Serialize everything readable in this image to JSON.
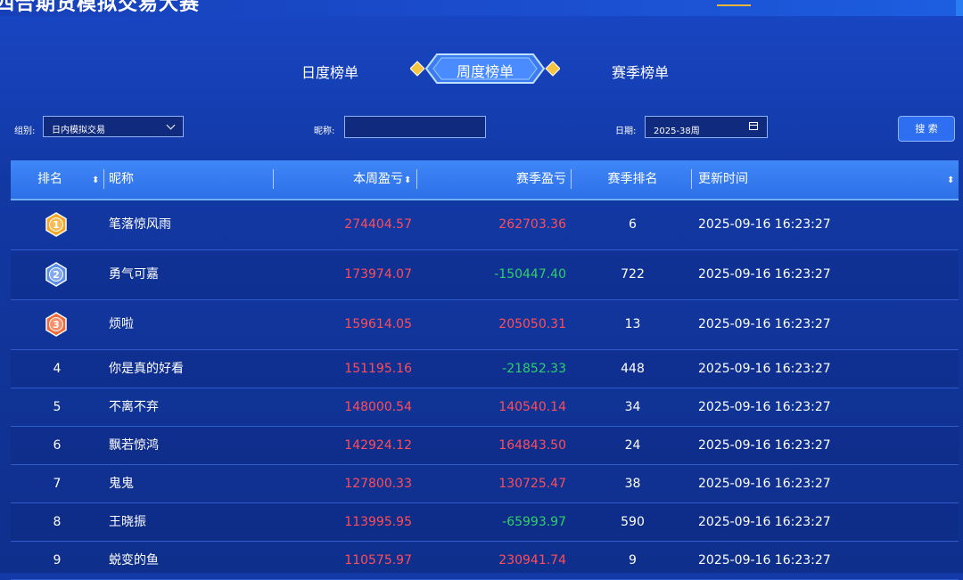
{
  "header": {
    "title": "四合期货模拟交易大赛"
  },
  "tabs": [
    {
      "label": "日度榜单",
      "active": false
    },
    {
      "label": "周度榜单",
      "active": true
    },
    {
      "label": "赛季榜单",
      "active": false
    }
  ],
  "filters": {
    "group_label": "组别:",
    "group_value": "日内模拟交易",
    "nickname_label": "昵称:",
    "nickname_value": "",
    "date_label": "日期:",
    "date_value": "2025-38周",
    "search_label": "搜 索"
  },
  "table": {
    "columns": [
      "排名",
      "昵称",
      "本周盈亏",
      "赛季盈亏",
      "赛季排名",
      "更新时间"
    ],
    "sort_glyph": "⬍",
    "rows": [
      {
        "rank": "1",
        "name": "笔落惊风雨",
        "week": "274404.57",
        "season": "262703.36",
        "season_sign": "pos",
        "season_rank": "6",
        "time": "2025-09-16 16:23:27"
      },
      {
        "rank": "2",
        "name": "勇气可嘉",
        "week": "173974.07",
        "season": "-150447.40",
        "season_sign": "neg",
        "season_rank": "722",
        "time": "2025-09-16 16:23:27"
      },
      {
        "rank": "3",
        "name": "烦啦",
        "week": "159614.05",
        "season": "205050.31",
        "season_sign": "pos",
        "season_rank": "13",
        "time": "2025-09-16 16:23:27"
      },
      {
        "rank": "4",
        "name": "你是真的好看",
        "week": "151195.16",
        "season": "-21852.33",
        "season_sign": "neg",
        "season_rank": "448",
        "time": "2025-09-16 16:23:27"
      },
      {
        "rank": "5",
        "name": "不离不弃",
        "week": "148000.54",
        "season": "140540.14",
        "season_sign": "pos",
        "season_rank": "34",
        "time": "2025-09-16 16:23:27"
      },
      {
        "rank": "6",
        "name": "飘若惊鸿",
        "week": "142924.12",
        "season": "164843.50",
        "season_sign": "pos",
        "season_rank": "24",
        "time": "2025-09-16 16:23:27"
      },
      {
        "rank": "7",
        "name": "鬼鬼",
        "week": "127800.33",
        "season": "130725.47",
        "season_sign": "pos",
        "season_rank": "38",
        "time": "2025-09-16 16:23:27"
      },
      {
        "rank": "8",
        "name": "王晓振",
        "week": "113995.95",
        "season": "-65993.97",
        "season_sign": "neg",
        "season_rank": "590",
        "time": "2025-09-16 16:23:27"
      },
      {
        "rank": "9",
        "name": "蜕变的鱼",
        "week": "110575.97",
        "season": "230941.74",
        "season_sign": "pos",
        "season_rank": "9",
        "time": "2025-09-16 16:23:27"
      }
    ]
  },
  "colors": {
    "positive": "#ff4d5a",
    "negative": "#2ed06a",
    "gold": "#f5a623",
    "silver": "#5b8de8",
    "bronze": "#f06a3a"
  },
  "icons": {
    "medal_1": "gold-medal-icon",
    "medal_2": "silver-medal-icon",
    "medal_3": "bronze-medal-icon",
    "calendar": "calendar-icon",
    "dropdown": "chevron-down-icon"
  }
}
